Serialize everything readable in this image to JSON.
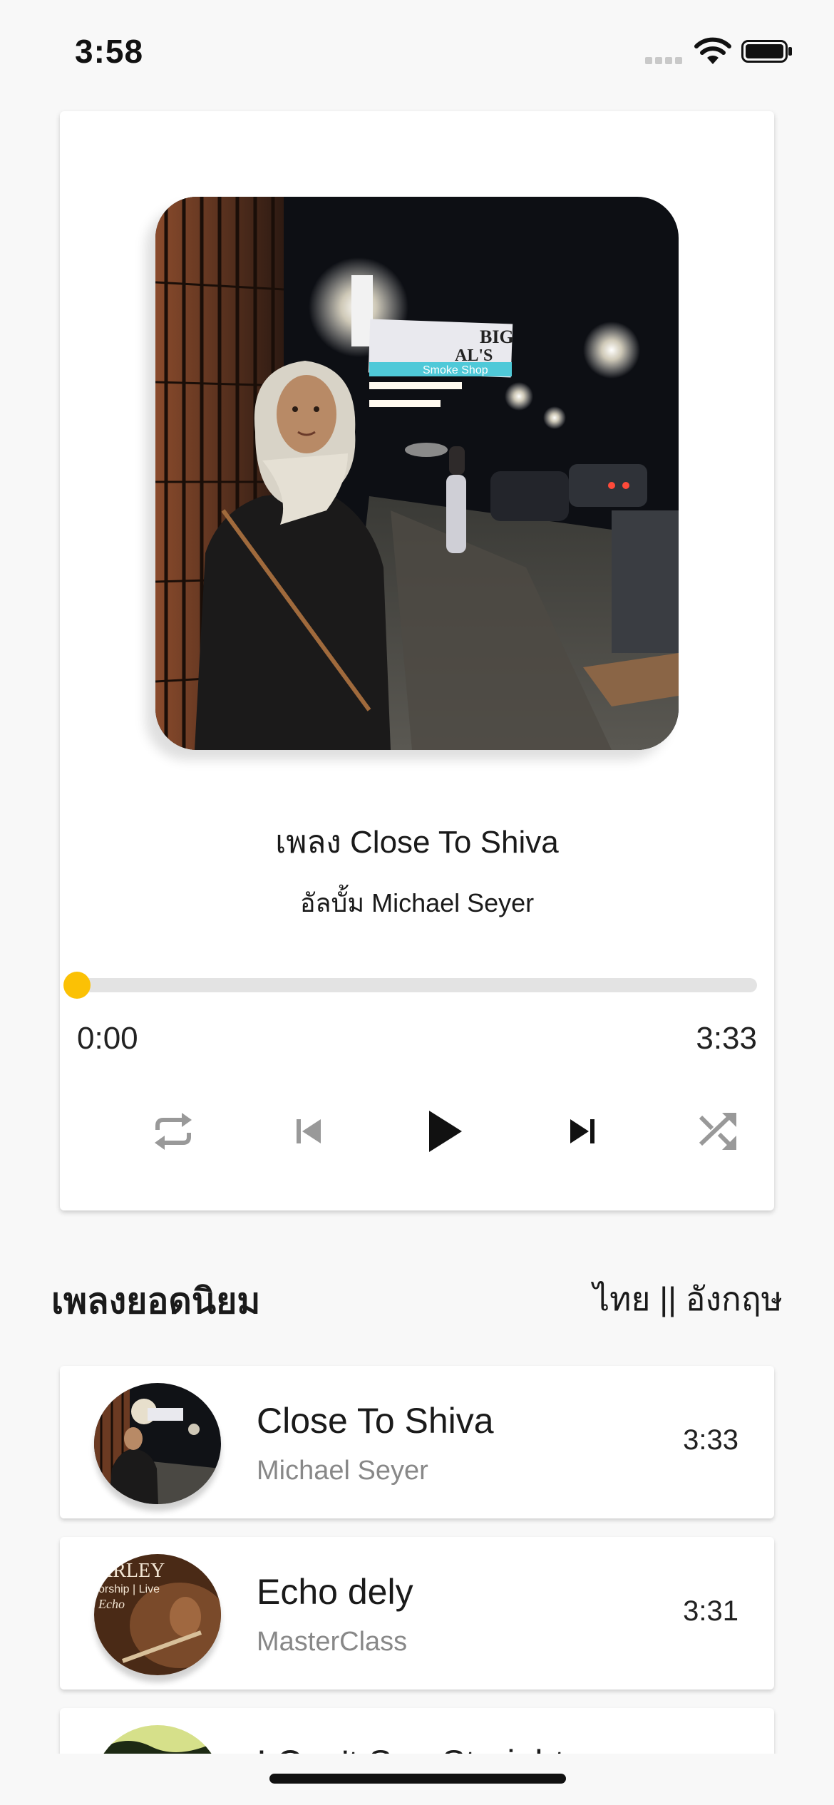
{
  "status_bar": {
    "time": "3:58",
    "icons": [
      "signal-icon",
      "wifi-icon",
      "battery-icon"
    ]
  },
  "player": {
    "song_title": "เพลง Close To Shiva",
    "album_label": "อัลบั้ม Michael Seyer",
    "progress": 0.0,
    "current_time": "0:00",
    "total_time": "3:33",
    "accent_color": "#fbc105",
    "controls": [
      "repeat-icon",
      "previous-icon",
      "play-icon",
      "next-icon",
      "shuffle-icon"
    ]
  },
  "section": {
    "title": "เพลงยอดนิยม",
    "language_toggle": "ไทย || อังกฤษ"
  },
  "tracks": [
    {
      "title": "Close To Shiva",
      "artist": "Michael Seyer",
      "duration": "3:33"
    },
    {
      "title": "Echo dely",
      "artist": "MasterClass",
      "duration": "3:31"
    },
    {
      "title": "I Can't See Straight",
      "artist": "",
      "duration": ""
    }
  ],
  "cover_texts": {
    "sign_line1": "BIG",
    "sign_line2": "AL'S",
    "sign_line3": "Smoke Shop",
    "echo_line1": "ARLEY",
    "echo_line2": "orship | Live",
    "echo_line3": "Echo"
  }
}
